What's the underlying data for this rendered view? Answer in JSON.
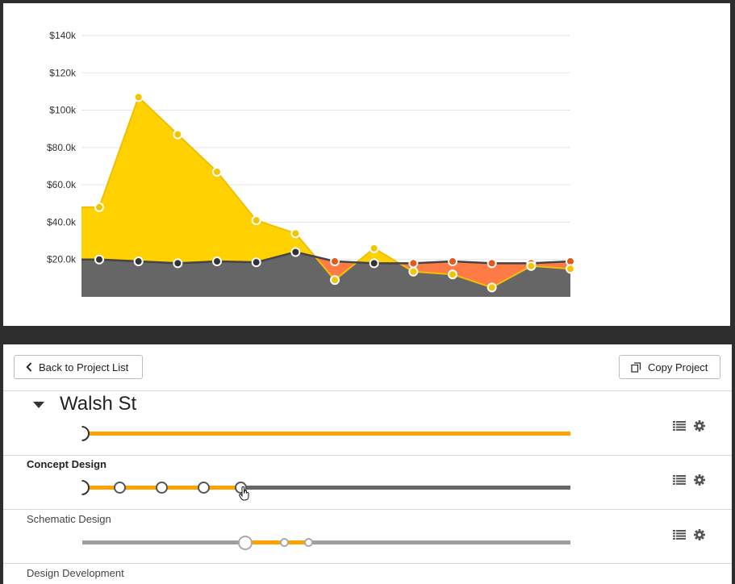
{
  "chart_data": {
    "type": "area",
    "x": [
      1,
      2,
      3,
      4,
      5,
      6,
      7,
      8,
      9,
      10,
      11,
      12,
      13
    ],
    "yticks": [
      "$20.0k",
      "$40.0k",
      "$60.0k",
      "$80.0k",
      "$100k",
      "$120k",
      "$140k"
    ],
    "ylim": [
      0,
      140000
    ],
    "grid": true,
    "series": [
      {
        "values": [
          48000,
          107000,
          87000,
          67000,
          41000,
          34000,
          9000,
          26000,
          13500,
          12000,
          5000,
          16500,
          15000
        ],
        "color": "#ffd100"
      },
      {
        "values": [
          20000,
          19000,
          18000,
          19000,
          18500,
          24000,
          19000,
          18000,
          18000,
          19000,
          18000,
          18000,
          19000
        ],
        "color": "#666666"
      }
    ],
    "overage_color": "#ff7b45"
  },
  "header": {
    "back_label": "Back to Project List",
    "copy_label": "Copy Project"
  },
  "project": {
    "title": "Walsh St",
    "progress": 0.0
  },
  "phases": [
    {
      "title": "Concept Design",
      "milestones": 4,
      "completed": 4
    },
    {
      "title": "Schematic Design"
    },
    {
      "title": "Design Development"
    }
  ],
  "colors": {
    "accent": "#ffa200",
    "track_dark": "#666666",
    "track_light": "#9e9e9e"
  },
  "icons": [
    "chevron-left-icon",
    "copy-icon",
    "caret-down-icon",
    "list-icon",
    "gear-icon"
  ]
}
